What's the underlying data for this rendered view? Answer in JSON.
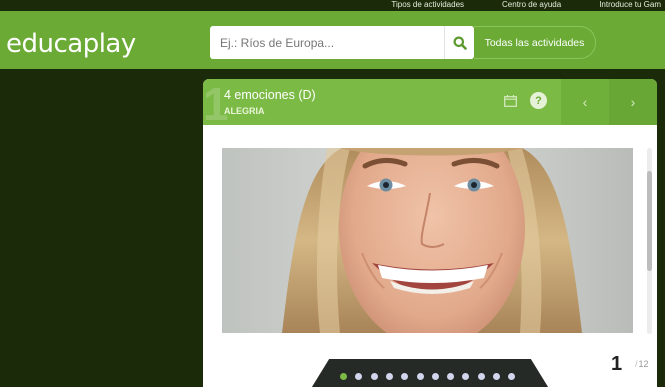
{
  "top_links": [
    "Tipos de actividades",
    "Centro de ayuda",
    "Introduce tu Gam"
  ],
  "brand": {
    "logo": "educaplay",
    "green": "#6aaa35",
    "dark": "#1b2a08"
  },
  "search": {
    "placeholder": "Ej.: Ríos de Europa...",
    "icon": "search-icon",
    "all_activities_label": "Todas las actividades"
  },
  "activity": {
    "number": "1",
    "title": "4 emociones (D)",
    "subtitle": "ALEGRIA",
    "icons": [
      "calendar-icon",
      "help-icon"
    ],
    "help_glyph": "?",
    "prev_glyph": "‹",
    "next_glyph": "›"
  },
  "pagination": {
    "current": "1",
    "total": "12",
    "dots": 12,
    "active_dot": 1
  }
}
